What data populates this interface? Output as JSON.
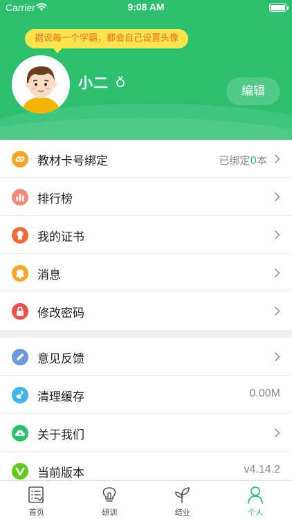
{
  "status_bar": {
    "carrier": "Carrier",
    "time": "9:08 AM"
  },
  "profile": {
    "tip": "据说每一个学霸，都会自己设置头像",
    "username": "小二",
    "edit_label": "编辑"
  },
  "menu_group_1": [
    {
      "label": "教材卡号绑定",
      "value_prefix": "已绑定",
      "value_count": "0",
      "value_suffix": "本",
      "icon": "link-icon",
      "color": "#f5a623"
    },
    {
      "label": "排行榜",
      "icon": "bar-chart-icon",
      "color": "#ef8b78"
    },
    {
      "label": "我的证书",
      "icon": "award-icon",
      "color": "#f26a3b"
    },
    {
      "label": "消息",
      "icon": "bell-icon",
      "color": "#f5a623"
    },
    {
      "label": "修改密码",
      "icon": "lock-icon",
      "color": "#ee4e4e"
    }
  ],
  "menu_group_2": [
    {
      "label": "意见反馈",
      "icon": "pencil-icon",
      "color": "#6b9bd6"
    },
    {
      "label": "清理缓存",
      "value": "0.00M",
      "icon": "broom-icon",
      "color": "#3fb5e9"
    },
    {
      "label": "关于我们",
      "icon": "cloud-icon",
      "color": "#2bbf6e"
    },
    {
      "label": "当前版本",
      "value": "v4.14.2",
      "icon": "version-icon",
      "color": "#5ecb1e"
    }
  ],
  "tabbar": [
    {
      "label": "首页",
      "icon": "list-icon"
    },
    {
      "label": "研训",
      "icon": "lightbulb-icon"
    },
    {
      "label": "结业",
      "icon": "sprout-icon"
    },
    {
      "label": "个人",
      "icon": "person-icon",
      "active": true
    }
  ],
  "colors": {
    "brand": "#2bbf6e",
    "tip_bg": "#ffe44d",
    "tip_text": "#f26b1d"
  }
}
